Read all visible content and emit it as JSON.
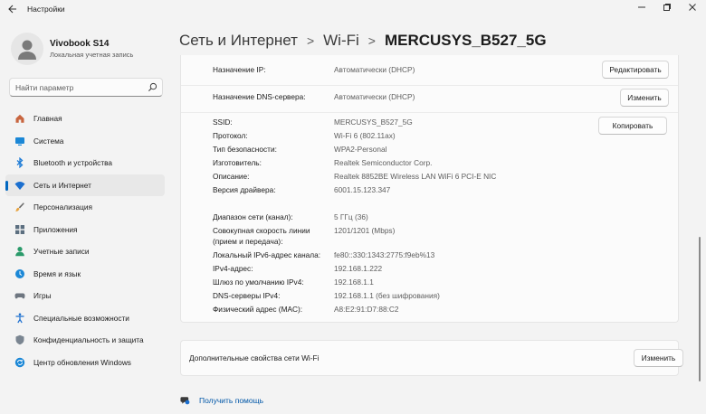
{
  "app": {
    "title": "Настройки"
  },
  "window_controls": {
    "minimize": "—",
    "maximize": "▢",
    "close": "✕"
  },
  "user": {
    "name": "Vivobook S14",
    "account_type": "Локальная учетная запись"
  },
  "search": {
    "placeholder": "Найти параметр"
  },
  "sidebar": {
    "items": [
      {
        "label": "Главная",
        "icon": "home-icon"
      },
      {
        "label": "Система",
        "icon": "system-icon"
      },
      {
        "label": "Bluetooth и устройства",
        "icon": "bluetooth-icon"
      },
      {
        "label": "Сеть и Интернет",
        "icon": "wifi-icon",
        "active": true
      },
      {
        "label": "Персонализация",
        "icon": "brush-icon"
      },
      {
        "label": "Приложения",
        "icon": "apps-icon"
      },
      {
        "label": "Учетные записи",
        "icon": "accounts-icon"
      },
      {
        "label": "Время и язык",
        "icon": "time-language-icon"
      },
      {
        "label": "Игры",
        "icon": "gaming-icon"
      },
      {
        "label": "Специальные возможности",
        "icon": "accessibility-icon"
      },
      {
        "label": "Конфиденциальность и защита",
        "icon": "shield-icon"
      },
      {
        "label": "Центр обновления Windows",
        "icon": "update-icon"
      }
    ]
  },
  "breadcrumb": {
    "level1": "Сеть и Интернет",
    "separator": ">",
    "level2": "Wi-Fi",
    "current": "MERCUSYS_B527_5G"
  },
  "ip_settings": {
    "ip_label": "Назначение IP:",
    "ip_value": "Автоматически (DHCP)",
    "ip_button": "Редактировать",
    "dns_label": "Назначение DNS-сервера:",
    "dns_value": "Автоматически (DHCP)",
    "dns_button": "Изменить"
  },
  "properties": {
    "copy_button": "Копировать",
    "rows": [
      {
        "label": "SSID:",
        "value": "MERCUSYS_B527_5G"
      },
      {
        "label": "Протокол:",
        "value": "Wi-Fi 6 (802.11ax)"
      },
      {
        "label": "Тип безопасности:",
        "value": "WPA2-Personal"
      },
      {
        "label": "Изготовитель:",
        "value": "Realtek Semiconductor Corp."
      },
      {
        "label": "Описание:",
        "value": "Realtek 8852BE Wireless LAN WiFi 6 PCI-E NIC"
      },
      {
        "label": "Версия драйвера:",
        "value": "6001.15.123.347"
      },
      {
        "label": "Диапазон сети (канал):",
        "value": "5 ГГц (36)"
      },
      {
        "label": "Совокупная скорость линии",
        "label2": "(прием и передача):",
        "value": "1201/1201 (Mbps)"
      },
      {
        "label": "Локальный IPv6-адрес канала:",
        "value": "fe80::330:1343:2775:f9eb%13"
      },
      {
        "label": "IPv4-адрес:",
        "value": "192.168.1.222"
      },
      {
        "label": "Шлюз по умолчанию IPv4:",
        "value": "192.168.1.1"
      },
      {
        "label": "DNS-серверы IPv4:",
        "value": "192.168.1.1 (без шифрования)"
      },
      {
        "label": "Физический адрес (MAC):",
        "value": "A8:E2:91:D7:88:C2"
      }
    ]
  },
  "additional": {
    "label": "Дополнительные свойства сети Wi-Fi",
    "button": "Изменить"
  },
  "help": {
    "label": "Получить помощь"
  },
  "colors": {
    "accent": "#0067c0",
    "link": "#0057a8",
    "background": "#f3f3f3",
    "card": "#fbfbfb"
  }
}
